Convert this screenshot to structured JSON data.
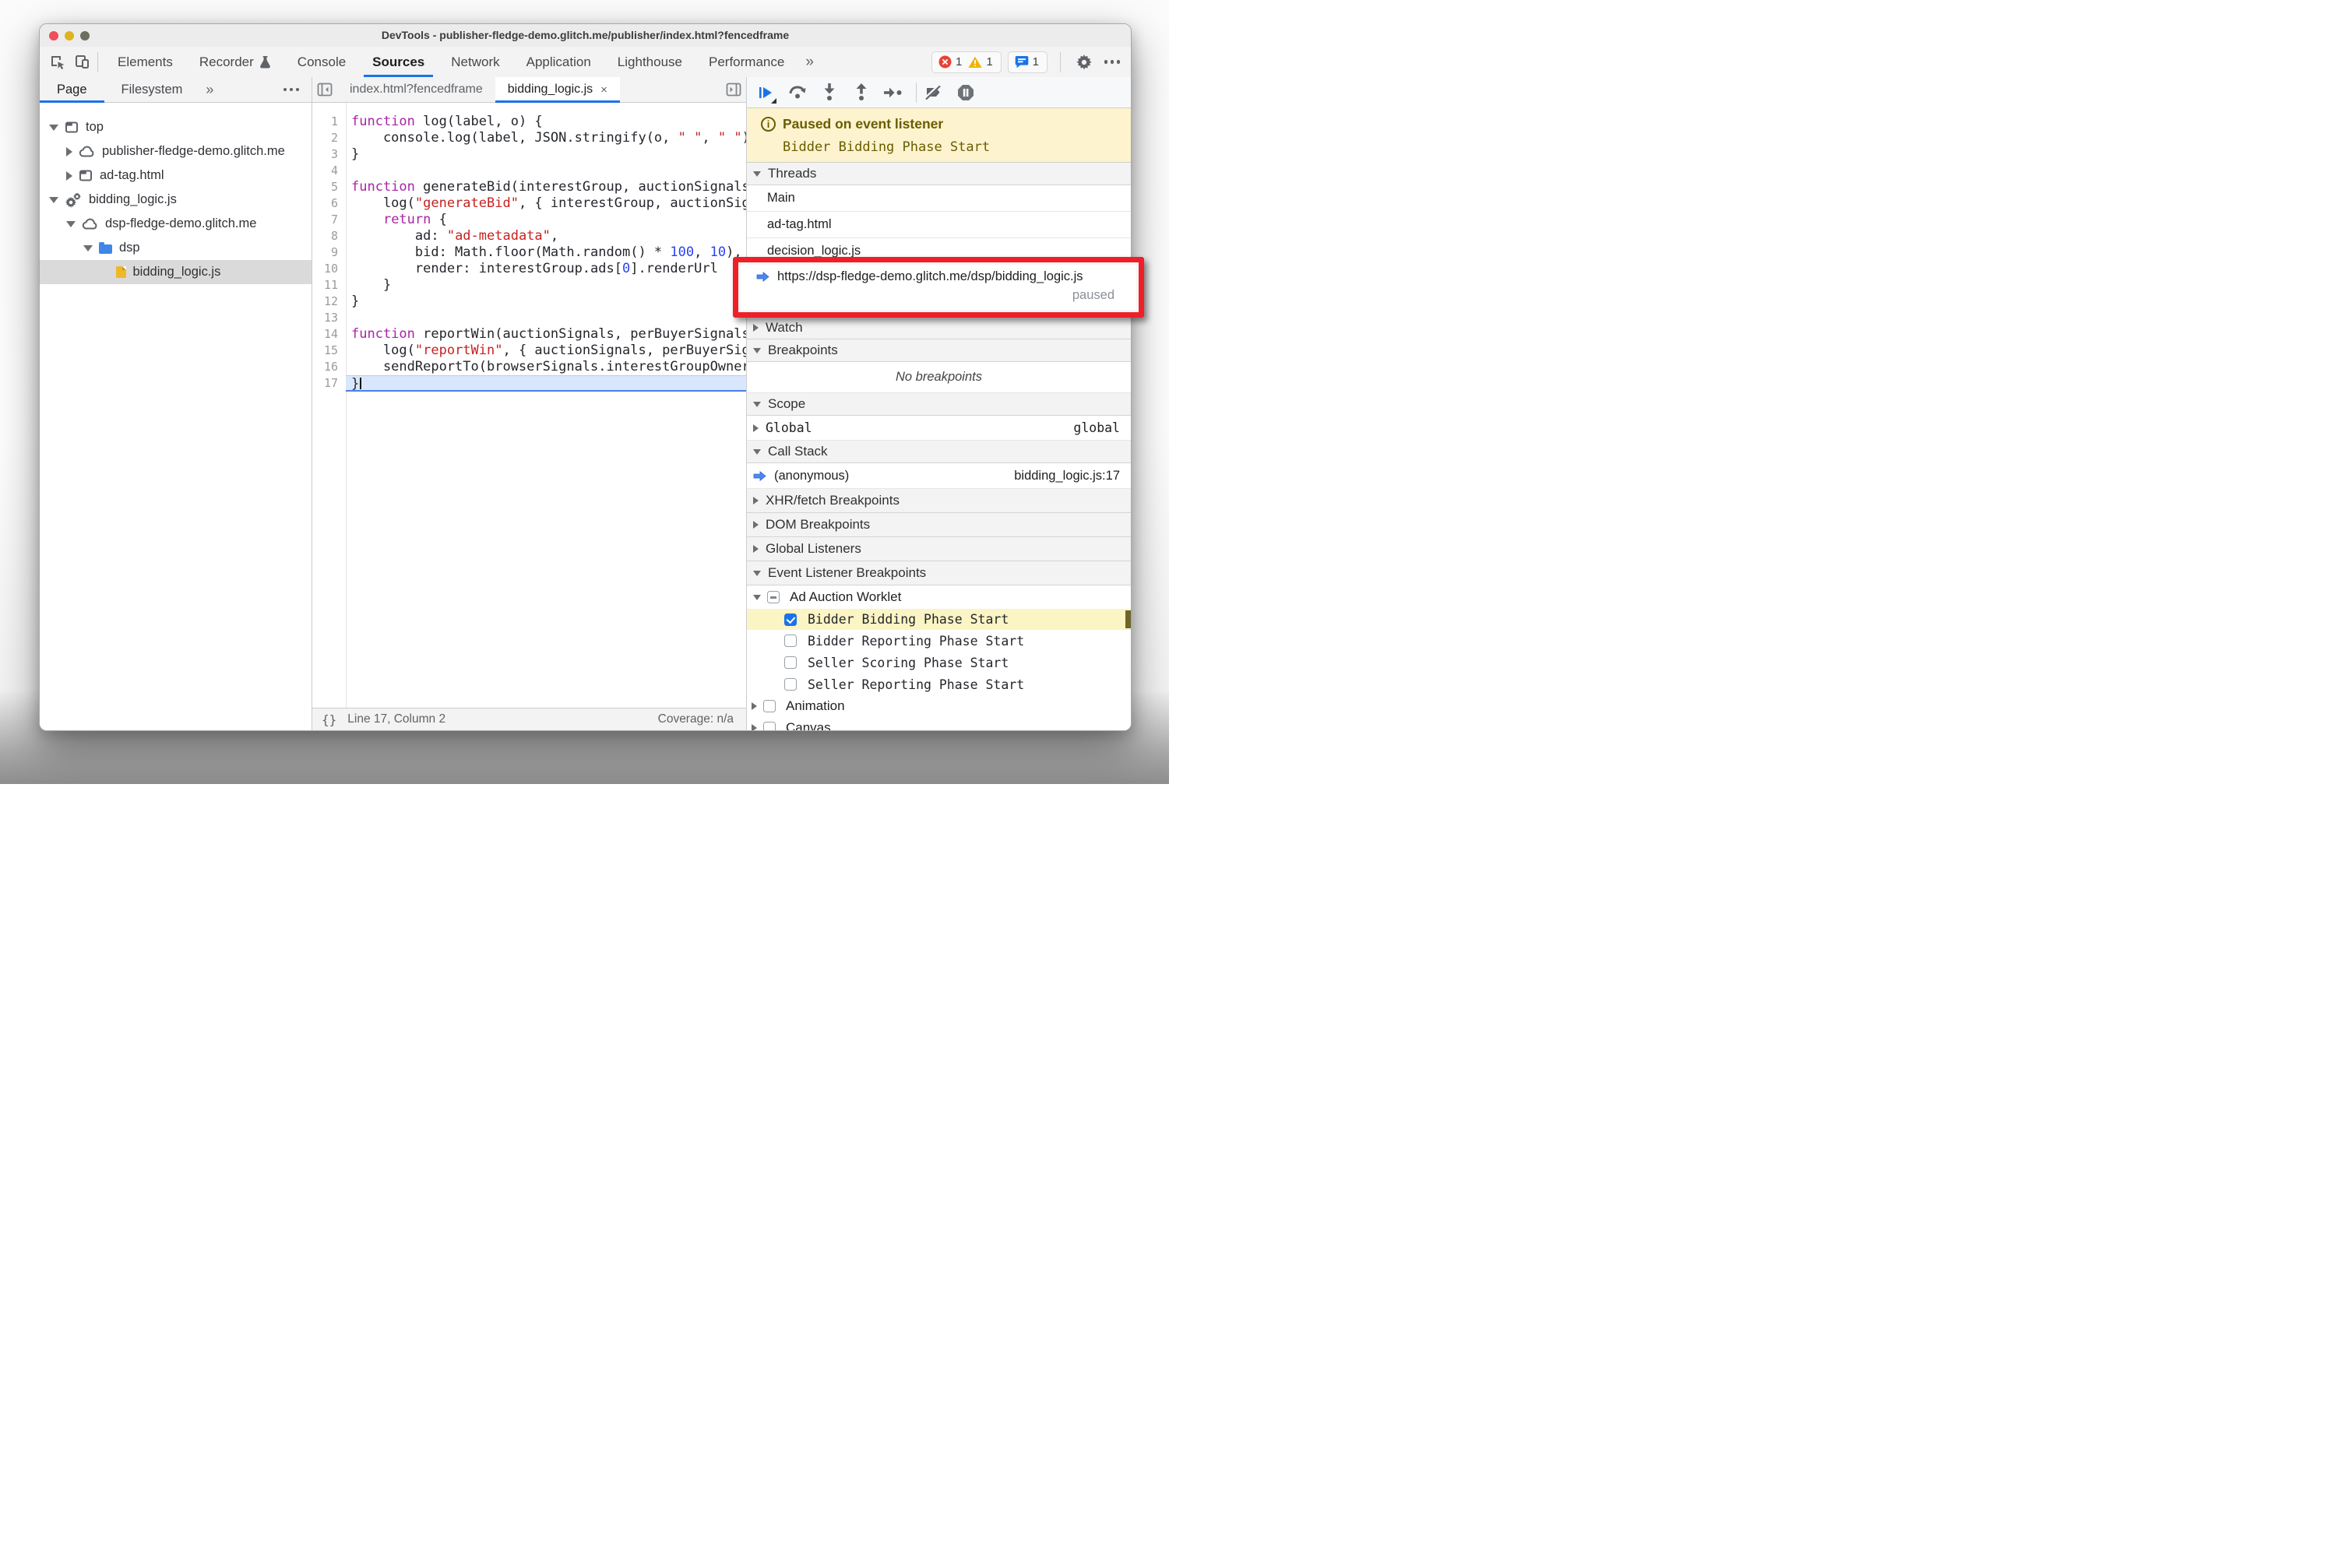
{
  "window_title": "DevTools - publisher-fledge-demo.glitch.me/publisher/index.html?fencedframe",
  "main_toolbar": {
    "tabs": [
      {
        "label": "Elements"
      },
      {
        "label": "Recorder",
        "icon": "flask"
      },
      {
        "label": "Console"
      },
      {
        "label": "Sources",
        "selected": true
      },
      {
        "label": "Network"
      },
      {
        "label": "Application"
      },
      {
        "label": "Lighthouse"
      },
      {
        "label": "Performance"
      }
    ],
    "more_tabs_label": "»",
    "error_count": "1",
    "warning_count": "1",
    "issues_count": "1"
  },
  "sidebar": {
    "tabs": [
      {
        "label": "Page",
        "selected": true
      },
      {
        "label": "Filesystem",
        "selected": false
      }
    ],
    "more_label": "»",
    "tree": [
      {
        "label": "top",
        "icon": "frame",
        "depth": 0,
        "arrow": "down",
        "selected": false
      },
      {
        "label": "publisher-fledge-demo.glitch.me",
        "icon": "cloud",
        "depth": 1,
        "arrow": "right",
        "selected": false
      },
      {
        "label": "ad-tag.html",
        "icon": "frame",
        "depth": 1,
        "arrow": "right",
        "selected": false
      },
      {
        "label": "bidding_logic.js",
        "icon": "gears",
        "depth": 0,
        "arrow": "down",
        "selected": false
      },
      {
        "label": "dsp-fledge-demo.glitch.me",
        "icon": "cloud",
        "depth": 1,
        "arrow": "down",
        "selected": false
      },
      {
        "label": "dsp",
        "icon": "folder",
        "depth": 2,
        "arrow": "down",
        "selected": false
      },
      {
        "label": "bidding_logic.js",
        "icon": "file",
        "depth": 3,
        "arrow": "none",
        "selected": true
      }
    ]
  },
  "editor": {
    "tabs": [
      {
        "label": "index.html?fencedframe",
        "active": false,
        "closable": false
      },
      {
        "label": "bidding_logic.js",
        "active": true,
        "closable": true,
        "close_glyph": "×"
      }
    ],
    "lines": [
      {
        "n": "1",
        "tokens": [
          {
            "t": "function",
            "c": "k"
          },
          {
            "t": " log(label, o) {",
            "c": "d"
          }
        ]
      },
      {
        "n": "2",
        "tokens": [
          {
            "t": "    console.log(label, JSON.stringify(o, ",
            "c": "d"
          },
          {
            "t": "\" \"",
            "c": "s"
          },
          {
            "t": ", ",
            "c": "d"
          },
          {
            "t": "\" \"",
            "c": "s"
          },
          {
            "t": "));",
            "c": "d"
          }
        ]
      },
      {
        "n": "3",
        "tokens": [
          {
            "t": "}",
            "c": "d"
          }
        ]
      },
      {
        "n": "4",
        "tokens": []
      },
      {
        "n": "5",
        "tokens": [
          {
            "t": "function",
            "c": "k"
          },
          {
            "t": " generateBid(interestGroup, auctionSignals, perBuyerSignals",
            "c": "d"
          }
        ]
      },
      {
        "n": "6",
        "tokens": [
          {
            "t": "    log(",
            "c": "d"
          },
          {
            "t": "\"generateBid\"",
            "c": "s"
          },
          {
            "t": ", { interestGroup, auctionSignals, perBuyerSignals",
            "c": "d"
          }
        ]
      },
      {
        "n": "7",
        "tokens": [
          {
            "t": "    ",
            "c": "d"
          },
          {
            "t": "return",
            "c": "k"
          },
          {
            "t": " {",
            "c": "d"
          }
        ]
      },
      {
        "n": "8",
        "tokens": [
          {
            "t": "        ad: ",
            "c": "d"
          },
          {
            "t": "\"ad-metadata\"",
            "c": "s"
          },
          {
            "t": ",",
            "c": "d"
          }
        ]
      },
      {
        "n": "9",
        "tokens": [
          {
            "t": "        bid: Math.floor(Math.random() * ",
            "c": "d"
          },
          {
            "t": "100",
            "c": "n"
          },
          {
            "t": ", ",
            "c": "d"
          },
          {
            "t": "10",
            "c": "n"
          },
          {
            "t": "),",
            "c": "d"
          }
        ]
      },
      {
        "n": "10",
        "tokens": [
          {
            "t": "        render: interestGroup.ads[",
            "c": "d"
          },
          {
            "t": "0",
            "c": "n"
          },
          {
            "t": "].renderUrl",
            "c": "d"
          }
        ]
      },
      {
        "n": "11",
        "tokens": [
          {
            "t": "    }",
            "c": "d"
          }
        ]
      },
      {
        "n": "12",
        "tokens": [
          {
            "t": "}",
            "c": "d"
          }
        ]
      },
      {
        "n": "13",
        "tokens": []
      },
      {
        "n": "14",
        "tokens": [
          {
            "t": "function",
            "c": "k"
          },
          {
            "t": " reportWin(auctionSignals, perBuyerSignals, sellerSignals",
            "c": "d"
          }
        ]
      },
      {
        "n": "15",
        "tokens": [
          {
            "t": "    log(",
            "c": "d"
          },
          {
            "t": "\"reportWin\"",
            "c": "s"
          },
          {
            "t": ", { auctionSignals, perBuyerSignals, sellerSignals",
            "c": "d"
          }
        ]
      },
      {
        "n": "16",
        "tokens": [
          {
            "t": "    sendReportTo(browserSignals.interestGroupOwner);",
            "c": "d"
          }
        ]
      },
      {
        "n": "17",
        "tokens": [
          {
            "t": "}",
            "c": "d"
          }
        ],
        "highlighted": true,
        "caret": true
      }
    ],
    "status": {
      "position": "Line 17, Column 2",
      "coverage": "Coverage: n/a",
      "pretty_print_glyph": "{}"
    }
  },
  "debugger": {
    "paused_banner": {
      "title": "Paused on event listener",
      "detail": "Bidder Bidding Phase Start",
      "info_glyph": "i"
    },
    "threads": {
      "header": "Threads",
      "items": [
        {
          "label": "Main"
        },
        {
          "label": "ad-tag.html"
        },
        {
          "label": "decision_logic.js"
        }
      ],
      "active": {
        "url": "https://dsp-fledge-demo.glitch.me/dsp/bidding_logic.js",
        "status": "paused"
      }
    },
    "watch": {
      "header": "Watch"
    },
    "breakpoints": {
      "header": "Breakpoints",
      "empty": "No breakpoints"
    },
    "scope": {
      "header": "Scope",
      "item": "Global",
      "value": "global"
    },
    "call_stack": {
      "header": "Call Stack",
      "frame": "(anonymous)",
      "location": "bidding_logic.js:17"
    },
    "xhr": {
      "header": "XHR/fetch Breakpoints"
    },
    "dom": {
      "header": "DOM Breakpoints"
    },
    "global_listeners": {
      "header": "Global Listeners"
    },
    "event_listener_breakpoints": {
      "header": "Event Listener Breakpoints",
      "group": {
        "label": "Ad Auction Worklet",
        "state": "indeterminate"
      },
      "phases": [
        {
          "label": "Bidder Bidding Phase Start",
          "checked": true,
          "highlighted": true
        },
        {
          "label": "Bidder Reporting Phase Start",
          "checked": false,
          "highlighted": false
        },
        {
          "label": "Seller Scoring Phase Start",
          "checked": false,
          "highlighted": false
        },
        {
          "label": "Seller Reporting Phase Start",
          "checked": false,
          "highlighted": false
        }
      ],
      "categories": [
        {
          "label": "Animation"
        },
        {
          "label": "Canvas"
        }
      ]
    }
  },
  "colors": {
    "accent_blue": "#1a73e8",
    "paused_banner_bg": "#fdf3cf",
    "paused_text": "#6b5c00",
    "annotation_red": "#ef1f29",
    "highlight_yellow": "#fbf4c4",
    "selected_row_gray": "#dadada"
  }
}
